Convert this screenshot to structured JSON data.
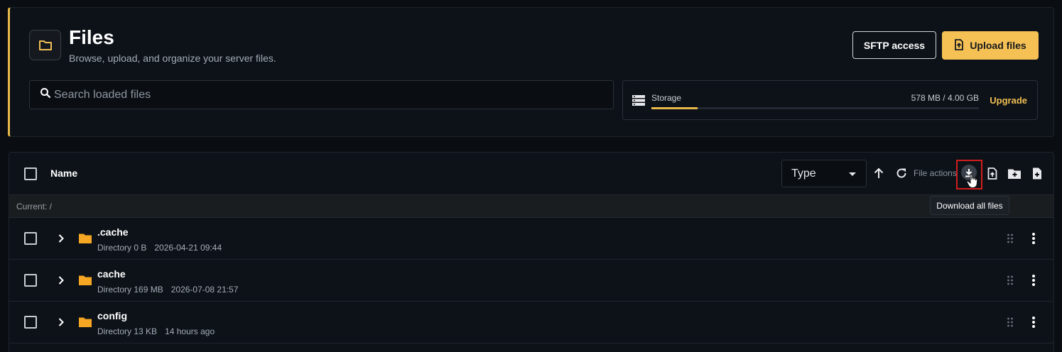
{
  "header": {
    "title": "Files",
    "subtitle": "Browse, upload, and organize your server files.",
    "sftp_label": "SFTP access",
    "upload_label": "Upload files",
    "accent_color": "#e8b84b"
  },
  "search": {
    "placeholder": "Search loaded files",
    "value": ""
  },
  "storage": {
    "label": "Storage",
    "usage_text": "578 MB / 4.00 GB",
    "used_fraction": 0.14,
    "upgrade_label": "Upgrade"
  },
  "toolbar": {
    "name_header": "Name",
    "sort_select": "Type",
    "file_actions_label": "File actions",
    "tooltip": "Download all files",
    "icons": [
      "arrow-up-icon",
      "refresh-icon",
      "download-icon",
      "upload-file-icon",
      "new-folder-icon",
      "new-file-icon"
    ]
  },
  "path": {
    "label": "Current: /"
  },
  "files": [
    {
      "name": ".cache",
      "kind": "Directory",
      "size": "0 B",
      "modified": "2026-04-21 09:44"
    },
    {
      "name": "cache",
      "kind": "Directory",
      "size": "169 MB",
      "modified": "2026-07-08 21:57"
    },
    {
      "name": "config",
      "kind": "Directory",
      "size": "13 KB",
      "modified": "14 hours ago"
    }
  ]
}
